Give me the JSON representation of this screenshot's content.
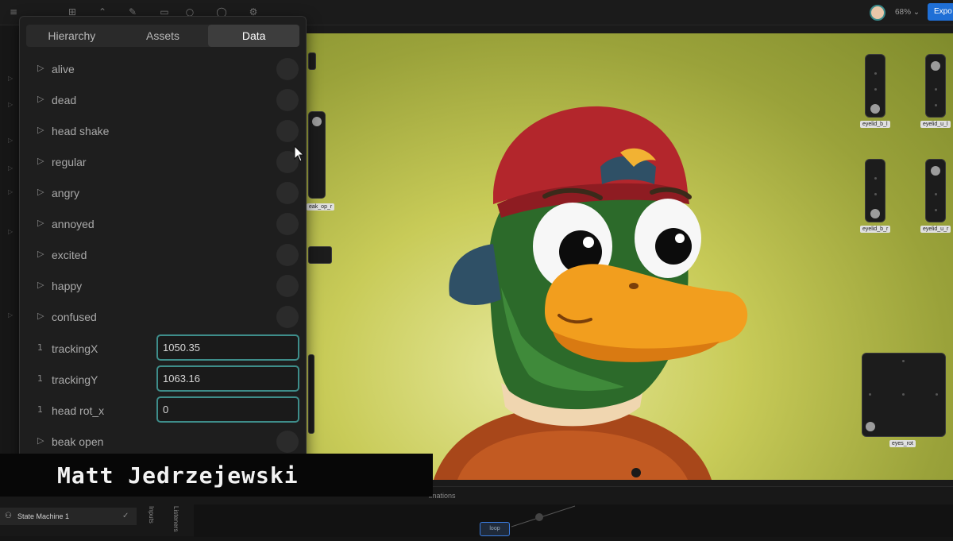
{
  "panel": {
    "tabs": [
      {
        "label": "Hierarchy",
        "active": false
      },
      {
        "label": "Assets",
        "active": false
      },
      {
        "label": "Data",
        "active": true
      }
    ],
    "rows": [
      {
        "icon": "triangle-right-icon",
        "label": "alive"
      },
      {
        "icon": "triangle-right-icon",
        "label": "dead"
      },
      {
        "icon": "triangle-right-icon",
        "label": "head shake"
      },
      {
        "icon": "triangle-right-icon",
        "label": "regular"
      },
      {
        "icon": "triangle-right-icon",
        "label": "angry"
      },
      {
        "icon": "triangle-right-icon",
        "label": "annoyed"
      },
      {
        "icon": "triangle-right-icon",
        "label": "excited"
      },
      {
        "icon": "triangle-right-icon",
        "label": "happy"
      },
      {
        "icon": "triangle-right-icon",
        "label": "confused"
      },
      {
        "icon": "number-icon",
        "glyph": "1",
        "label": "trackingX",
        "value": "1050.35"
      },
      {
        "icon": "number-icon",
        "glyph": "1",
        "label": "trackingY",
        "value": "1063.16"
      },
      {
        "icon": "number-icon",
        "glyph": "1",
        "label": "head rot_x",
        "value": "0"
      },
      {
        "icon": "triangle-right-icon",
        "label": "beak open"
      }
    ]
  },
  "topbar": {
    "zoom": "68% ⌄",
    "export_label": "Expo"
  },
  "controls": {
    "eyelid_b_l": "eyelid_b_l",
    "eyelid_u_l": "eyelid_u_l",
    "eyelid_b_r": "eyelid_b_r",
    "eyelid_u_r": "eyelid_u_r",
    "eyes_rot": "eyes_rot",
    "beak_op_r": "eak_op_r"
  },
  "bottom": {
    "state_machine_label": "State Machine 1",
    "inputs_label": "Inputs",
    "listeners_label": "Listeners",
    "animations_label": "imations",
    "loop_label": "loop"
  },
  "caption": {
    "name": "Matt Jedrzejewski"
  },
  "colors": {
    "accent_input_border": "#3e8d8a",
    "export_button": "#1f6fd6",
    "artboard_bg": "#b6bc4a"
  }
}
